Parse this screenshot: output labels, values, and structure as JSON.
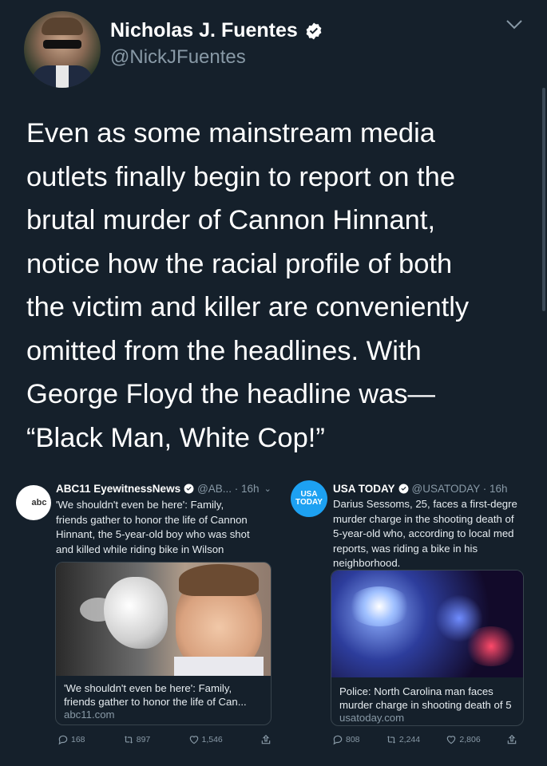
{
  "tweet": {
    "author": {
      "display_name": "Nicholas J. Fuentes",
      "handle": "@NickJFuentes"
    },
    "text_lines": [
      "Even as some mainstream media",
      "outlets finally begin to report on the",
      "brutal murder of Cannon Hinnant,",
      "notice how the racial profile of both",
      "the victim and killer are conveniently",
      "omitted from the headlines. With",
      "George Floyd the headline was—",
      "“Black Man, White Cop!”"
    ]
  },
  "embeds": [
    {
      "name": "ABC11 EyewitnessNews",
      "meta": "@AB... · 16h",
      "logo_text": "abc",
      "body_lines": [
        "'We shouldn't even be here': Family,",
        "friends gather to honor the life of Cannon",
        "Hinnant, the 5-year-old boy who was shot",
        "and killed while riding bike in Wilson"
      ],
      "card_title_lines": [
        "'We shouldn't even be here': Family,",
        "friends gather to honor the life of Can..."
      ],
      "card_url": "abc11.com",
      "replies": "168",
      "retweets": "897",
      "likes": "1,546"
    },
    {
      "name": "USA TODAY",
      "meta": "@USATODAY · 16h",
      "logo_line1": "USA",
      "logo_line2": "TODAY",
      "body_lines": [
        "Darius Sessoms, 25, faces a first-degre",
        "murder charge in the shooting death of",
        "5-year-old who, according to local med",
        "reports, was riding a bike in his",
        "neighborhood."
      ],
      "card_title_lines": [
        "Police: North Carolina man faces",
        "murder charge in shooting death of 5"
      ],
      "card_url": "usatoday.com",
      "replies": "808",
      "retweets": "2,244",
      "likes": "2,806"
    }
  ],
  "colors": {
    "background": "#15202b",
    "verified": "#ffffff",
    "secondary_text": "#8899a6",
    "border": "#38444d"
  }
}
